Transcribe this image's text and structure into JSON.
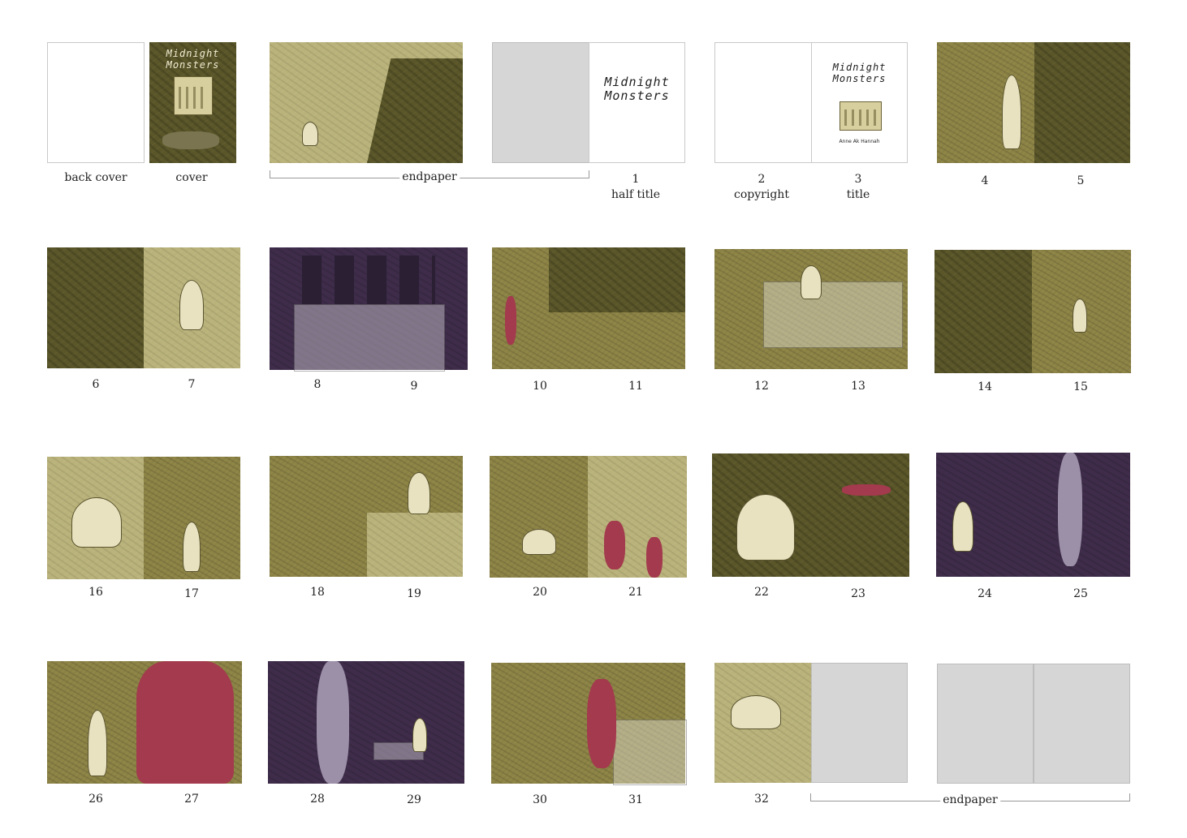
{
  "book": {
    "title_line1": "Midnight",
    "title_line2": "Monsters",
    "author": "Anne Ak Hannah"
  },
  "labels": {
    "back_cover": "back cover",
    "cover": "cover",
    "endpaper": "endpaper",
    "p1": "1",
    "half_title": "half title",
    "p2": "2",
    "copyright": "copyright",
    "p3": "3",
    "title": "title",
    "p4": "4",
    "p5": "5",
    "p6": "6",
    "p7": "7",
    "p8": "8",
    "p9": "9",
    "p10": "10",
    "p11": "11",
    "p12": "12",
    "p13": "13",
    "p14": "14",
    "p15": "15",
    "p16": "16",
    "p17": "17",
    "p18": "18",
    "p19": "19",
    "p20": "20",
    "p21": "21",
    "p22": "22",
    "p23": "23",
    "p24": "24",
    "p25": "25",
    "p26": "26",
    "p27": "27",
    "p28": "28",
    "p29": "29",
    "p30": "30",
    "p31": "31",
    "p32": "32"
  },
  "colors": {
    "olive_light": "#b9b27a",
    "olive_mid": "#8e8547",
    "olive_dark": "#5a5629",
    "night_purple": "#3e2c4a",
    "monster_red": "#a33a4d",
    "blank_grey": "#d6d6d6"
  }
}
